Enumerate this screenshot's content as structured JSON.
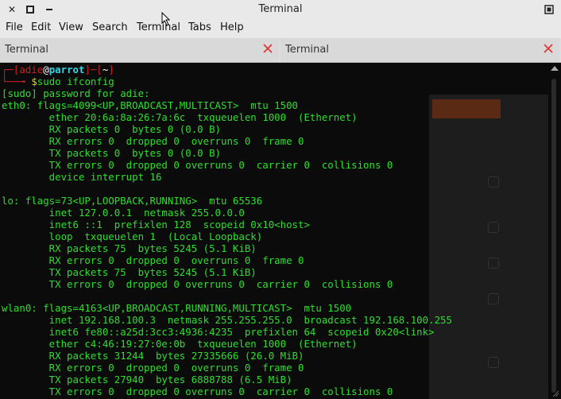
{
  "window": {
    "title": "Terminal"
  },
  "menu": [
    "File",
    "Edit",
    "View",
    "Search",
    "Terminal",
    "Tabs",
    "Help"
  ],
  "tabs": [
    {
      "label": "Terminal"
    },
    {
      "label": "Terminal"
    }
  ],
  "prompt": {
    "frame_open": "┌─[",
    "user": "adie",
    "at": "@",
    "host": "parrot",
    "sep": "]─[",
    "cwd": "~",
    "frame_close": "]",
    "cont": "└──╼ ",
    "dollar": "$",
    "command": "sudo ifconfig"
  },
  "output": [
    "[sudo] password for adie:",
    "eth0: flags=4099<UP,BROADCAST,MULTICAST>  mtu 1500",
    "        ether 20:6a:8a:26:7a:6c  txqueuelen 1000  (Ethernet)",
    "        RX packets 0  bytes 0 (0.0 B)",
    "        RX errors 0  dropped 0  overruns 0  frame 0",
    "        TX packets 0  bytes 0 (0.0 B)",
    "        TX errors 0  dropped 0 overruns 0  carrier 0  collisions 0",
    "        device interrupt 16",
    "",
    "lo: flags=73<UP,LOOPBACK,RUNNING>  mtu 65536",
    "        inet 127.0.0.1  netmask 255.0.0.0",
    "        inet6 ::1  prefixlen 128  scopeid 0x10<host>",
    "        loop  txqueuelen 1  (Local Loopback)",
    "        RX packets 75  bytes 5245 (5.1 KiB)",
    "        RX errors 0  dropped 0  overruns 0  frame 0",
    "        TX packets 75  bytes 5245 (5.1 KiB)",
    "        TX errors 0  dropped 0 overruns 0  carrier 0  collisions 0",
    "",
    "wlan0: flags=4163<UP,BROADCAST,RUNNING,MULTICAST>  mtu 1500",
    "        inet 192.168.100.3  netmask 255.255.255.0  broadcast 192.168.100.255",
    "        inet6 fe80::a25d:3cc3:4936:4235  prefixlen 64  scopeid 0x20<link>",
    "        ether c4:46:19:27:0e:0b  txqueuelen 1000  (Ethernet)",
    "        RX packets 31244  bytes 27335666 (26.0 MiB)",
    "        RX errors 0  dropped 0  overruns 0  frame 0",
    "        TX packets 27940  bytes 6888788 (6.5 MiB)",
    "        TX errors 0  dropped 0 overruns 0  carrier 0  collisions 0"
  ],
  "colors": {
    "terminal_text": "#2ddf2d",
    "prompt_frame": "#cc2222",
    "host": "#34d6e6",
    "dollar": "#f0d000",
    "background": "#0b0b0b",
    "close_icon": "#e03030"
  },
  "icons": {
    "window_close": "close-x-icon",
    "window_maximize": "maximize-square-icon",
    "window_minimize": "minimize-dash-icon",
    "tab_close": "red-x-icon",
    "window_unmaximize": "restore-square-icon"
  }
}
